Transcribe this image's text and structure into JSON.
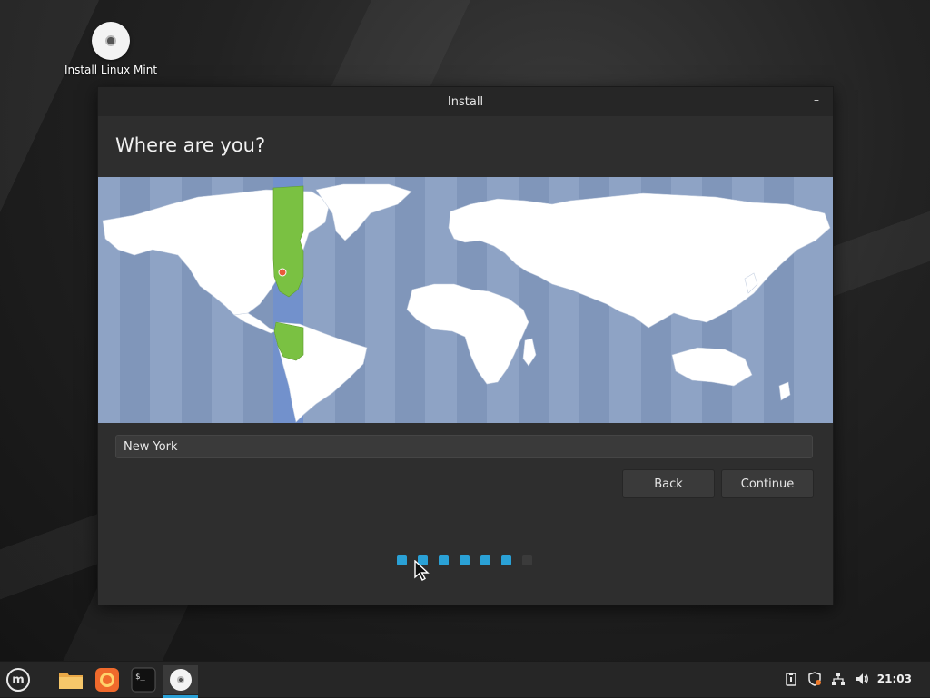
{
  "desktop": {
    "icon_label": "Install Linux Mint"
  },
  "window": {
    "title": "Install",
    "minimize_glyph": "–",
    "heading": "Where are you?",
    "timezone_value": "New York",
    "back_label": "Back",
    "continue_label": "Continue",
    "progress": {
      "total_steps": 7,
      "completed_steps": 6
    }
  },
  "map": {
    "selected_city": "New York",
    "highlight_color": "#7ac142",
    "land_color": "#ffffff",
    "water_color": "#8aa0c2"
  },
  "taskbar": {
    "icons": [
      "mint-menu-icon",
      "folder-icon",
      "firefox-icon",
      "terminal-icon",
      "disc-icon"
    ],
    "tray_icons": [
      "clipboard-icon",
      "shield-icon",
      "network-icon",
      "volume-icon"
    ],
    "clock": "21:03"
  },
  "colors": {
    "accent": "#2aa1d6",
    "window_bg": "#2e2e2e",
    "titlebar_bg": "#262626"
  }
}
